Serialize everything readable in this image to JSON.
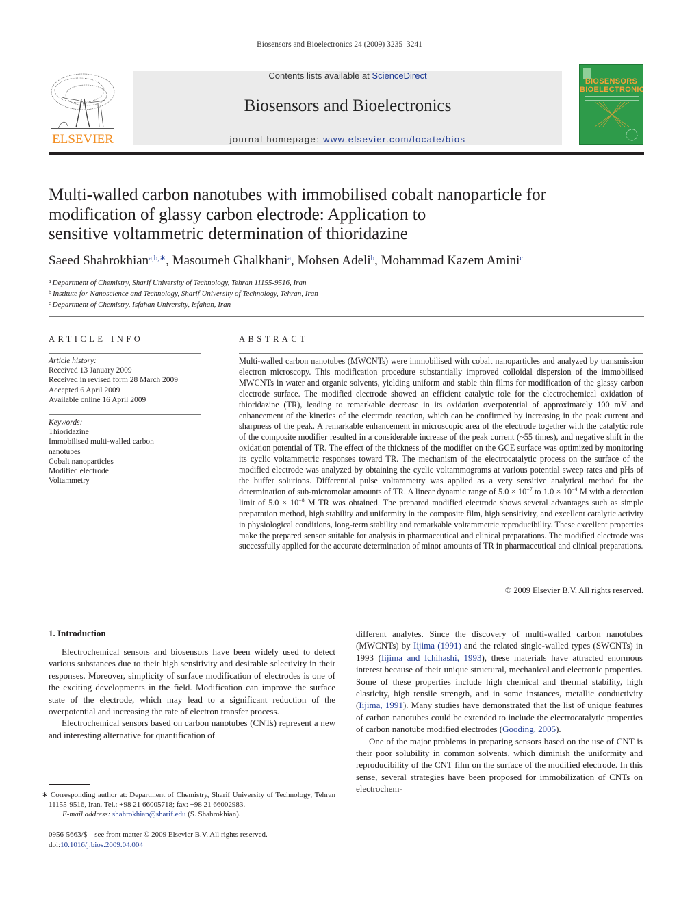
{
  "running_header": "Biosensors and Bioelectronics 24 (2009) 3235–3241",
  "masthead": {
    "publisher": "ELSEVIER",
    "publisher_logo_icon": "elsevier-tree-logo",
    "contents_prefix": "Contents lists available at ",
    "contents_link": "ScienceDirect",
    "journal_title": "Biosensors and Bioelectronics",
    "homepage_prefix": "journal homepage: ",
    "homepage_url": "www.elsevier.com/locate/bios",
    "cover": {
      "line1": "BIOSENSORS",
      "line2": "BIOELECTRONICS",
      "color": "#2e9b4a",
      "text_color": "#f6a23a"
    }
  },
  "article": {
    "title_lines": [
      "Multi-walled carbon nanotubes with immobilised cobalt nanoparticle for",
      "modification of glassy carbon electrode: Application to",
      "sensitive voltammetric determination of thioridazine"
    ],
    "authors": [
      {
        "name": "Saeed Shahrokhian",
        "sup": "a,b,∗"
      },
      {
        "name": "Masoumeh Ghalkhani",
        "sup": "a"
      },
      {
        "name": "Mohsen Adeli",
        "sup": "b"
      },
      {
        "name": "Mohammad Kazem Amini",
        "sup": "c"
      }
    ],
    "affiliations": [
      {
        "mark": "a",
        "text": "Department of Chemistry, Sharif University of Technology, Tehran 11155-9516, Iran"
      },
      {
        "mark": "b",
        "text": "Institute for Nanoscience and Technology, Sharif University of Technology, Tehran, Iran"
      },
      {
        "mark": "c",
        "text": "Department of Chemistry, Isfahan University, Isfahan, Iran"
      }
    ]
  },
  "article_info": {
    "heading": "ARTICLE INFO",
    "history_label": "Article history:",
    "history": [
      "Received 13 January 2009",
      "Received in revised form 28 March 2009",
      "Accepted 6 April 2009",
      "Available online 16 April 2009"
    ],
    "keywords_label": "Keywords:",
    "keywords": [
      "Thioridazine",
      "Immobilised multi-walled carbon nanotubes",
      "Cobalt nanoparticles",
      "Modified electrode",
      "Voltammetry"
    ]
  },
  "abstract": {
    "heading": "ABSTRACT",
    "text_part1": "Multi-walled carbon nanotubes (MWCNTs) were immobilised with cobalt nanoparticles and analyzed by transmission electron microscopy. This modification procedure substantially improved colloidal dispersion of the immobilised MWCNTs in water and organic solvents, yielding uniform and stable thin films for modification of the glassy carbon electrode surface. The modified electrode showed an efficient catalytic role for the electrochemical oxidation of thioridazine (TR), leading to remarkable decrease in its oxidation overpotential of approximately 100 mV and enhancement of the kinetics of the electrode reaction, which can be confirmed by increasing in the peak current and sharpness of the peak. A remarkable enhancement in microscopic area of the electrode together with the catalytic role of the composite modifier resulted in a considerable increase of the peak current (~55 times), and negative shift in the oxidation potential of TR. The effect of the thickness of the modifier on the GCE surface was optimized by monitoring its cyclic voltammetric responses toward TR. The mechanism of the electrocatalytic process on the surface of the modified electrode was analyzed by obtaining the cyclic voltammograms at various potential sweep rates and pHs of the buffer solutions. Differential pulse voltammetry was applied as a very sensitive analytical method for the determination of sub-micromolar amounts of TR. A linear dynamic range of 5.0 × 10",
    "exp1": "−7",
    "text_part2": " to 1.0 × 10",
    "exp2": "−4",
    "text_part3": " M with a detection limit of 5.0 × 10",
    "exp3": "−8",
    "text_part4": " M TR was obtained. The prepared modified electrode shows several advantages such as simple preparation method, high stability and uniformity in the composite film, high sensitivity, and excellent catalytic activity in physiological conditions, long-term stability and remarkable voltammetric reproducibility. These excellent properties make the prepared sensor suitable for analysis in pharmaceutical and clinical preparations. The modified electrode was successfully applied for the accurate determination of minor amounts of TR in pharmaceutical and clinical preparations.",
    "copyright": "© 2009 Elsevier B.V. All rights reserved."
  },
  "body": {
    "intro_heading": "1.  Introduction",
    "left_p1": "Electrochemical sensors and biosensors have been widely used to detect various substances due to their high sensitivity and desirable selectivity in their responses. Moreover, simplicity of surface modification of electrodes is one of the exciting developments in the field. Modification can improve the surface state of the electrode, which may lead to a significant reduction of the overpotential and increasing the rate of electron transfer process.",
    "left_p2": "Electrochemical sensors based on carbon nanotubes (CNTs) represent a new and interesting alternative for quantification of",
    "right_p1": {
      "t1": "different analytes. Since the discovery of multi-walled carbon nanotubes (MWCNTs) by ",
      "ref1": "Iijima (1991)",
      "t2": " and the related single-walled types (SWCNTs) in 1993 (",
      "ref2": "Iijima and Ichihashi, 1993",
      "t3": "), these materials have attracted enormous interest because of their unique structural, mechanical and electronic properties. Some of these properties include high chemical and thermal stability, high elasticity, high tensile strength, and in some instances, metallic conductivity (",
      "ref3": "Iijima, 1991",
      "t4": "). Many studies have demonstrated that the list of unique features of carbon nanotubes could be extended to include the electrocatalytic properties of carbon nanotube modified electrodes (",
      "ref4": "Gooding, 2005",
      "t5": ")."
    },
    "right_p2": "One of the major problems in preparing sensors based on the use of CNT is their poor solubility in common solvents, which diminish the uniformity and reproducibility of the CNT film on the surface of the modified electrode. In this sense, several strategies have been proposed for immobilization of CNTs on electrochem-"
  },
  "footnote": {
    "corresponding": "∗  Corresponding author at: Department of Chemistry, Sharif University of Technology, Tehran 11155-9516, Iran. Tel.: +98 21 66005718; fax: +98 21 66002983.",
    "email_label": "E-mail address: ",
    "email": "shahrokhian@sharif.edu",
    "email_suffix": " (S. Shahrokhian)."
  },
  "front_matter": {
    "issn_line": "0956-5663/$ – see front matter © 2009 Elsevier B.V. All rights reserved.",
    "doi_prefix": "doi:",
    "doi": "10.1016/j.bios.2009.04.004"
  }
}
